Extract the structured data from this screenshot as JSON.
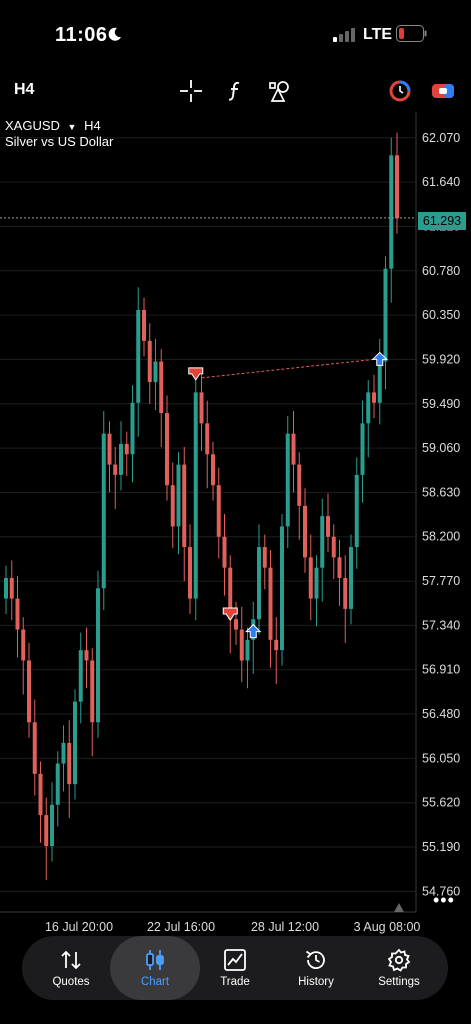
{
  "status": {
    "time": "11:06",
    "network": "LTE"
  },
  "toolbar": {
    "timeframe": "H4"
  },
  "chart_info": {
    "symbol": "XAGUSD",
    "symbol_timeframe": "H4",
    "description": "Silver vs US Dollar",
    "current_price": "61.293"
  },
  "chart_data": {
    "type": "candlestick",
    "y_ticks": [
      "62.070",
      "61.640",
      "61.210",
      "60.780",
      "60.350",
      "59.920",
      "59.490",
      "59.060",
      "58.630",
      "58.200",
      "57.770",
      "57.340",
      "56.910",
      "56.480",
      "56.050",
      "55.620",
      "55.190",
      "54.760"
    ],
    "x_ticks": [
      "16 Jul 20:00",
      "22 Jul 16:00",
      "28 Jul 12:00",
      "3 Aug 08:00"
    ],
    "ylim": [
      54.56,
      62.32
    ],
    "last_price": 61.293,
    "markers": [
      {
        "type": "sell",
        "index": 33,
        "price": 59.78
      },
      {
        "type": "sell",
        "index": 39,
        "price": 57.45
      },
      {
        "type": "buy",
        "index": 43,
        "price": 57.28
      },
      {
        "type": "buy",
        "index": 65,
        "price": 59.92
      }
    ],
    "colors": {
      "up": "#2a9d8f",
      "down": "#e0605a",
      "grid": "#1e1e1e",
      "marker_sell": "#e0443c",
      "marker_buy": "#2f7df2"
    }
  },
  "nav": {
    "items": [
      {
        "label": "Quotes",
        "icon": "quotes-icon"
      },
      {
        "label": "Chart",
        "icon": "chart-icon"
      },
      {
        "label": "Trade",
        "icon": "trade-icon"
      },
      {
        "label": "History",
        "icon": "history-icon"
      },
      {
        "label": "Settings",
        "icon": "settings-icon"
      }
    ],
    "active": "Chart"
  },
  "more_label": "•••"
}
